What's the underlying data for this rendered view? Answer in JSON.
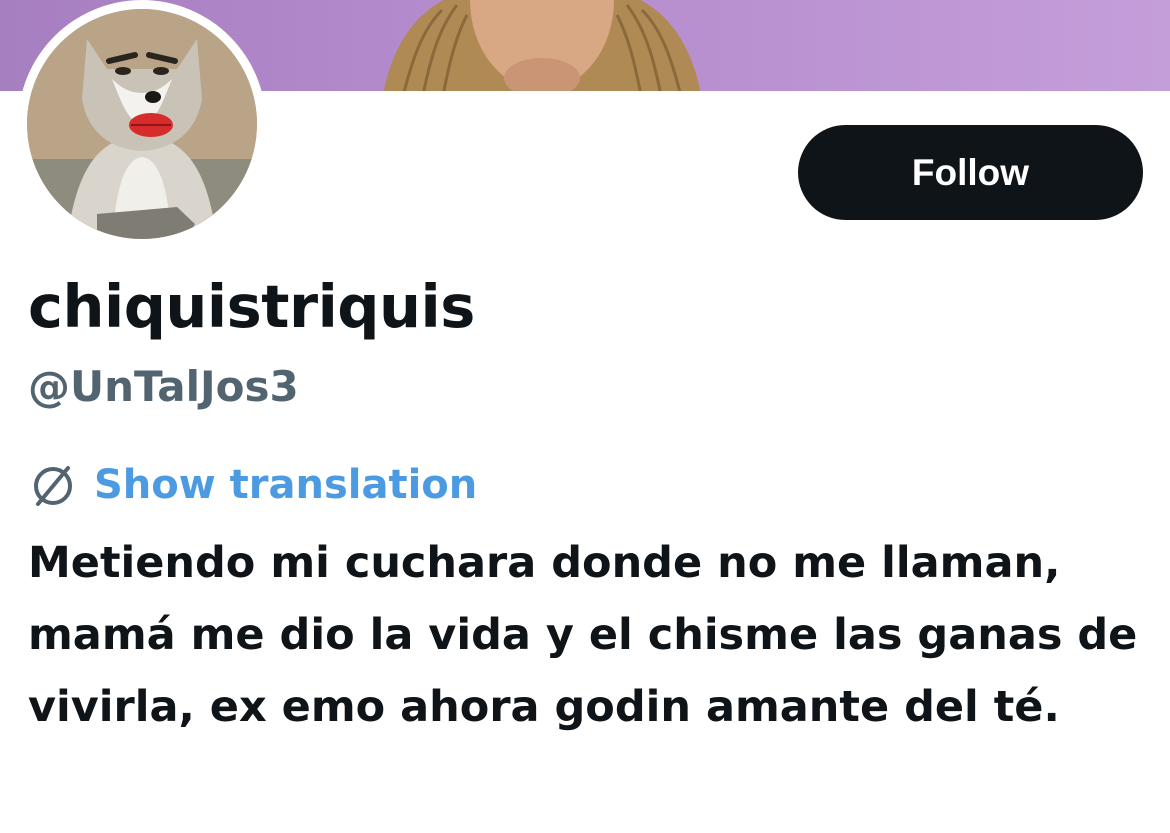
{
  "profile": {
    "display_name": "chiquistriquis",
    "handle": "@UnTalJos3",
    "bio": "Metiendo mi cuchara donde no me llaman, mamá me dio la vida y el chisme las ganas de vivirla, ex emo ahora godin amante del té."
  },
  "actions": {
    "follow_label": "Follow",
    "show_translation_label": "Show translation"
  },
  "icons": {
    "translation": "translate-icon"
  },
  "colors": {
    "banner": "#b58ccd",
    "follow_button": "#0f1419",
    "link": "#4c9be2",
    "handle": "#536471",
    "text": "#0f1419"
  }
}
